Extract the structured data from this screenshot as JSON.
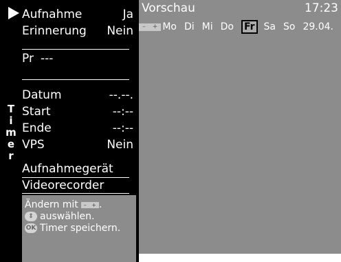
{
  "timer_menu": {
    "recording_label": "Aufnahme",
    "recording_value": "Ja",
    "reminder_label": "Erinnerung",
    "reminder_value": "Nein",
    "program_label": "Pr",
    "program_value": "---",
    "date_label": "Datum",
    "date_value": "--.--.",
    "start_label": "Start",
    "start_value": "--:--",
    "end_label": "Ende",
    "end_value": "--:--",
    "vps_label": "VPS",
    "vps_value": "Nein",
    "device_heading": "Aufnahmegerät",
    "device_value": "Videorecorder",
    "side_label": "Timer"
  },
  "help": {
    "line1": "Ändern mit",
    "line1_suffix": ".",
    "line2": "auswählen.",
    "line3": "Timer speichern.",
    "ok_label": "OK",
    "minus": "–",
    "plus": "+"
  },
  "preview": {
    "title": "Vorschau",
    "time": "17:23",
    "minus": "–",
    "plus": "+",
    "days": [
      "Mo",
      "Di",
      "Mi",
      "Do",
      "Fr",
      "Sa",
      "So"
    ],
    "selected_day": "Fr",
    "date": "29.04."
  }
}
